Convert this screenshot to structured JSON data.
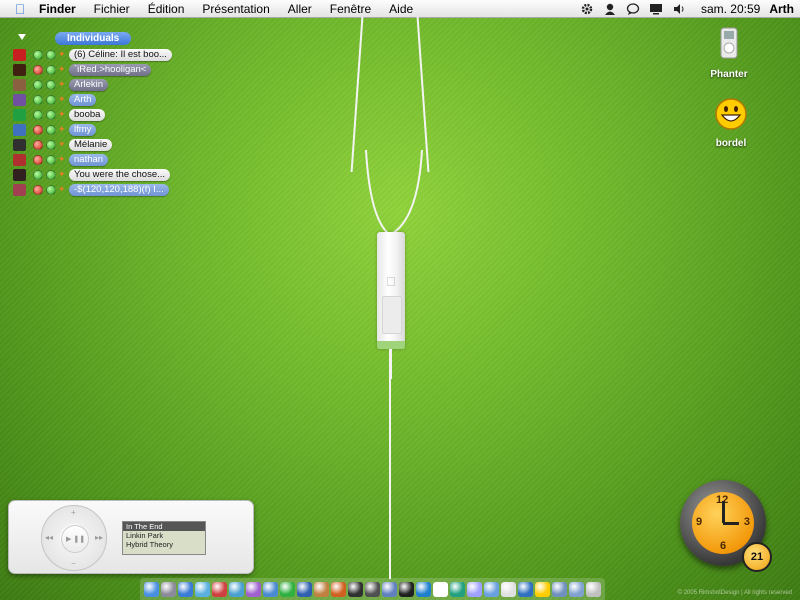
{
  "menubar": {
    "items": [
      {
        "label": "Finder",
        "bold": true
      },
      {
        "label": "Fichier"
      },
      {
        "label": "Édition"
      },
      {
        "label": "Présentation"
      },
      {
        "label": "Aller"
      },
      {
        "label": "Fenêtre"
      },
      {
        "label": "Aide"
      }
    ],
    "clock": "sam. 20:59",
    "user": "Arth",
    "status_icons": [
      "gear-icon",
      "user-icon",
      "chat-icon",
      "display-icon",
      "volume-icon"
    ]
  },
  "buddy_list": {
    "group": "Individuals",
    "buddies": [
      {
        "name": "(6) Céline: Il est boo...",
        "status": "on",
        "style": "light"
      },
      {
        "name": "`iRed.>hooligan<",
        "status": "away",
        "style": "dark"
      },
      {
        "name": "Arlekin",
        "status": "on",
        "style": "dark"
      },
      {
        "name": "Arth",
        "status": "on",
        "style": "sel"
      },
      {
        "name": "booba",
        "status": "on",
        "style": "light"
      },
      {
        "name": "lfmy",
        "status": "away",
        "style": "sel"
      },
      {
        "name": "Mélanie",
        "status": "away",
        "style": "light"
      },
      {
        "name": "nathan",
        "status": "away",
        "style": "sel"
      },
      {
        "name": "You were the chose...",
        "status": "on",
        "style": "light"
      },
      {
        "name": "-$(120,120,188)(f) I...",
        "status": "away",
        "style": "sel"
      }
    ]
  },
  "desktop": {
    "icons": [
      {
        "label": "Phanter",
        "icon": "ipod-icon"
      },
      {
        "label": "bordel",
        "icon": "smiley-icon"
      }
    ]
  },
  "player": {
    "track": "In The End",
    "artist": "Linkin Park",
    "album": "Hybrid Theory",
    "wheel": {
      "menu": "MENU",
      "prev": "◂◂",
      "next": "▸▸",
      "play": "▶ ❚❚",
      "plus": "+",
      "minus": "−"
    }
  },
  "clock_widget": {
    "numerals": [
      "12",
      "3",
      "6",
      "9"
    ],
    "date": "21"
  },
  "copyright": "© 2005 RimshotDesign | All rights reserved",
  "dock": {
    "icons": [
      "finder-icon",
      "system-prefs-icon",
      "safari-icon",
      "mail-icon",
      "ical-icon",
      "network-icon",
      "itunes-icon",
      "iphoto-icon",
      "adium-icon",
      "xcode-icon",
      "guitar-icon",
      "preview-icon",
      "dashboard-icon",
      "camera-icon",
      "imovie-icon",
      "terminal-icon",
      "appstore-icon",
      "calendar-icon",
      "globe-icon",
      "game-icon",
      "photo-icon",
      "x11-icon",
      "quicktime-icon",
      "smiley-icon",
      "folder-icon",
      "downloads-icon",
      "trash-icon"
    ]
  },
  "colors": {
    "desktop": "#6cb52a",
    "accent": "#3d78d8",
    "online": "#28a020",
    "away": "#d02818",
    "clock_face": "#f39a0c"
  }
}
